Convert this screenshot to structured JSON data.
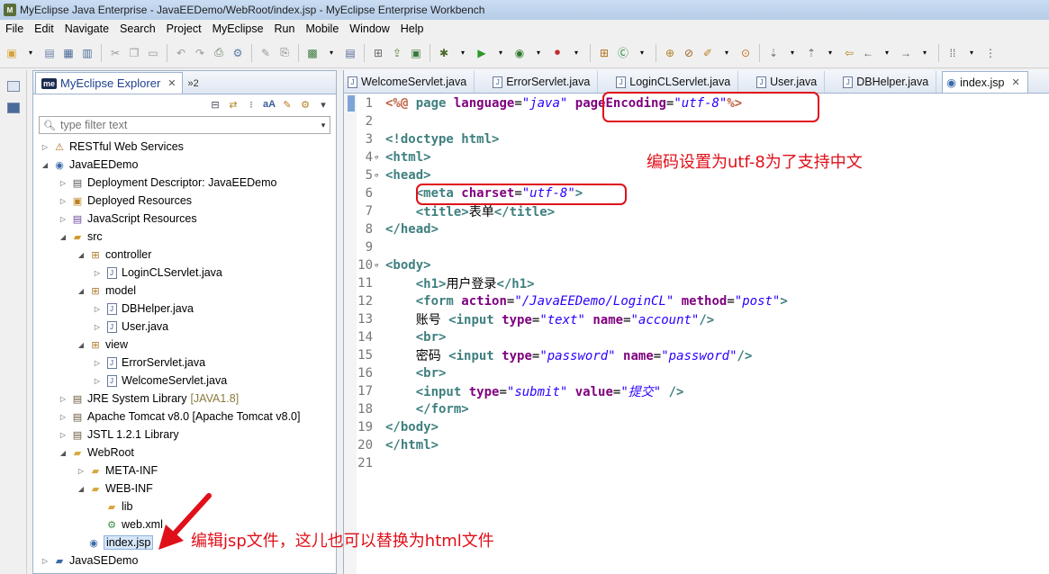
{
  "window": {
    "title": "MyEclipse Java Enterprise - JavaEEDemo/WebRoot/index.jsp - MyEclipse Enterprise Workbench"
  },
  "menu": [
    "File",
    "Edit",
    "Navigate",
    "Search",
    "Project",
    "MyEclipse",
    "Run",
    "Mobile",
    "Window",
    "Help"
  ],
  "explorer": {
    "logo": "me",
    "tab_label": "MyEclipse Explorer",
    "overflow": "»2",
    "filter_placeholder": "type filter text",
    "items": [
      {
        "label": "RESTful Web Services",
        "deco": ""
      },
      {
        "label": "JavaEEDemo",
        "deco": ""
      },
      {
        "label": "Deployment Descriptor: JavaEEDemo",
        "deco": ""
      },
      {
        "label": "Deployed Resources",
        "deco": ""
      },
      {
        "label": "JavaScript Resources",
        "deco": ""
      },
      {
        "label": "src",
        "deco": ""
      },
      {
        "label": "controller",
        "deco": ""
      },
      {
        "label": "LoginCLServlet.java",
        "deco": ""
      },
      {
        "label": "model",
        "deco": ""
      },
      {
        "label": "DBHelper.java",
        "deco": ""
      },
      {
        "label": "User.java",
        "deco": ""
      },
      {
        "label": "view",
        "deco": ""
      },
      {
        "label": "ErrorServlet.java",
        "deco": ""
      },
      {
        "label": "WelcomeServlet.java",
        "deco": ""
      },
      {
        "label": "JRE System Library",
        "deco": "[JAVA1.8]"
      },
      {
        "label": "Apache Tomcat v8.0 [Apache Tomcat v8.0]",
        "deco": ""
      },
      {
        "label": "JSTL 1.2.1 Library",
        "deco": ""
      },
      {
        "label": "WebRoot",
        "deco": ""
      },
      {
        "label": "META-INF",
        "deco": ""
      },
      {
        "label": "WEB-INF",
        "deco": ""
      },
      {
        "label": "lib",
        "deco": ""
      },
      {
        "label": "web.xml",
        "deco": ""
      },
      {
        "label": "index.jsp",
        "deco": ""
      },
      {
        "label": "JavaSEDemo",
        "deco": ""
      }
    ]
  },
  "editor": {
    "tabs": [
      "WelcomeServlet.java",
      "ErrorServlet.java",
      "LoginCLServlet.java",
      "User.java",
      "DBHelper.java",
      "index.jsp"
    ],
    "active_tab": "index.jsp",
    "lines": [
      "1",
      "2",
      "3",
      "4",
      "5",
      "6",
      "7",
      "8",
      "9",
      "10",
      "11",
      "12",
      "13",
      "14",
      "15",
      "16",
      "17",
      "18",
      "19",
      "20",
      "21"
    ]
  },
  "code": {
    "l1_a": "<%@ ",
    "l1_b": "page ",
    "l1_c": "language",
    "l1_d": "=",
    "l1_e": "\"java\"",
    "l1_f": " ",
    "l1_g": "pageEncoding",
    "l1_h": "=",
    "l1_i": "\"utf-8\"",
    "l1_j": "%>",
    "l3": "<!doctype html>",
    "l4": "<html>",
    "l5": "<head>",
    "l6_a": "<meta ",
    "l6_b": "charset",
    "l6_c": "=",
    "l6_d": "\"utf-8\"",
    "l6_e": ">",
    "l7_a": "<title>",
    "l7_b": "表单",
    "l7_c": "</title>",
    "l8": "</head>",
    "l10": "<body>",
    "l11_a": "<h1>",
    "l11_b": "用户登录",
    "l11_c": "</h1>",
    "l12_a": "<form ",
    "l12_b": "action",
    "l12_c": "=",
    "l12_d": "\"/JavaEEDemo/LoginCL\"",
    "l12_e": " method",
    "l12_f": "=",
    "l12_g": "\"post\"",
    "l12_h": ">",
    "l13_a": "账号 ",
    "l13_b": "<input ",
    "l13_c": "type",
    "l13_d": "=",
    "l13_e": "\"text\"",
    "l13_f": " name",
    "l13_g": "=",
    "l13_h": "\"account\"",
    "l13_i": "/>",
    "l14": "<br>",
    "l15_a": "密码 ",
    "l15_b": "<input ",
    "l15_c": "type",
    "l15_d": "=",
    "l15_e": "\"password\"",
    "l15_f": " name",
    "l15_g": "=",
    "l15_h": "\"password\"",
    "l15_i": "/>",
    "l16": "<br>",
    "l17_a": "<input ",
    "l17_b": "type",
    "l17_c": "=",
    "l17_d": "\"submit\"",
    "l17_e": " value",
    "l17_f": "=",
    "l17_g": "\"提交\"",
    "l17_h": " />",
    "l18": "</form>",
    "l19": "</body>",
    "l20": "</html>"
  },
  "annotations": {
    "encoding_note": "编码设置为utf-8为了支持中文",
    "edit_note": "编辑jsp文件，这儿也可以替换为html文件",
    "color": "#e0101a"
  }
}
